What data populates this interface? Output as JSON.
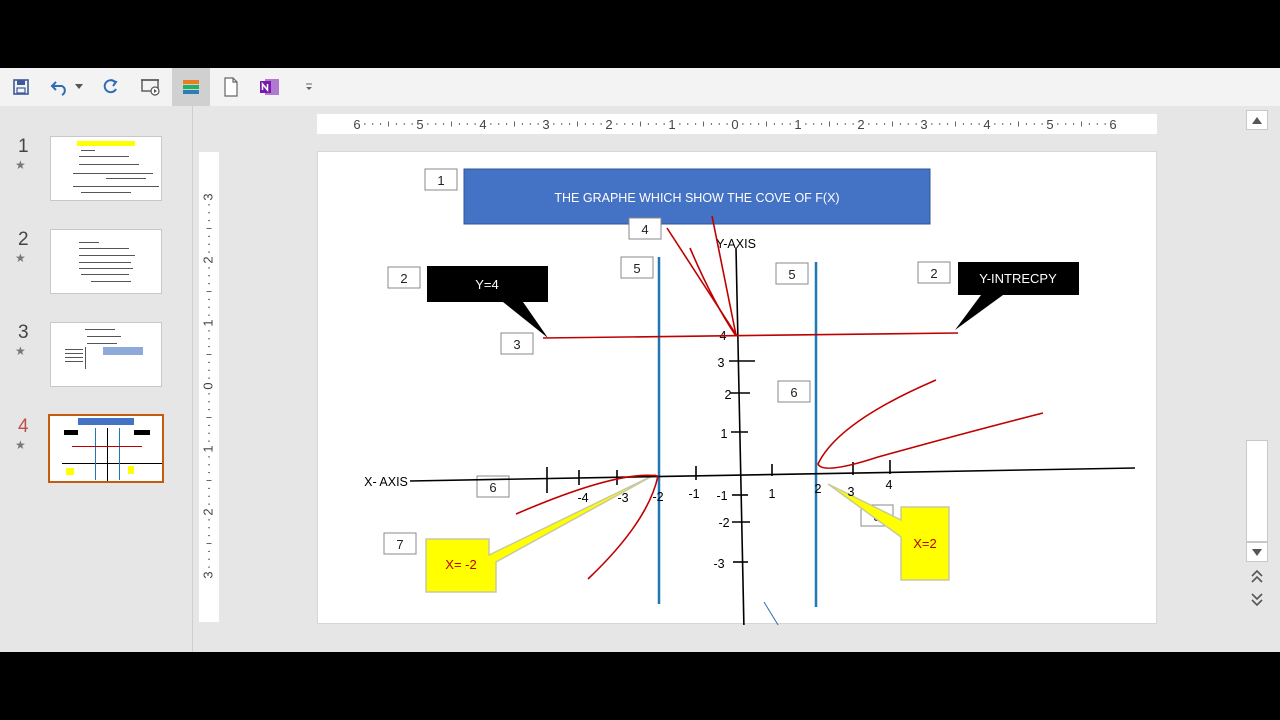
{
  "qat": {
    "icons": [
      "save-icon",
      "undo-icon",
      "undo-dropdown-icon",
      "redo-icon",
      "slideshow-from-start-icon",
      "layout-icon",
      "new-slide-icon",
      "onenote-icon",
      "customize-qat-icon"
    ]
  },
  "thumbnails": [
    {
      "number": "1",
      "active": false
    },
    {
      "number": "2",
      "active": false
    },
    {
      "number": "3",
      "active": false
    },
    {
      "number": "4",
      "active": true
    }
  ],
  "rulers": {
    "horizontal_labels": [
      "6",
      "5",
      "4",
      "3",
      "2",
      "1",
      "0",
      "1",
      "2",
      "3",
      "4",
      "5",
      "6"
    ],
    "vertical_labels": [
      "3",
      "2",
      "1",
      "0",
      "1",
      "2",
      "3"
    ]
  },
  "slide": {
    "title": "THE GRAPHE WHICH SHOW THE COVE OF F(X)",
    "y_axis_label": "Y-AXIS",
    "x_axis_label": "X- AXIS",
    "callouts": {
      "y4": "Y=4",
      "y_intercept": "Y-INTRECPY",
      "x_minus2": "X= -2",
      "x_plus2": "X=2"
    },
    "number_boxes": {
      "b1": "1",
      "b2a": "2",
      "b2b": "2",
      "b3": "3",
      "b4": "4",
      "b5a": "5",
      "b5b": "5",
      "b6a": "6",
      "b6b": "6",
      "b7": "7",
      "b8": "8"
    },
    "ticks": {
      "y4": "4",
      "y3": "3",
      "y2": "2",
      "y1": "1",
      "ym1": "-1",
      "ym2": "-2",
      "ym3": "-3",
      "xm4": "-4",
      "xm3": "-3",
      "xm2": "-2",
      "xm1": "-1",
      "x1": "1",
      "x2": "2",
      "x3": "3",
      "x4": "4"
    },
    "colors": {
      "title_fill": "#4472c4",
      "asymptote": "#1f77b4",
      "curve": "#c00000",
      "callout_black": "#000000",
      "callout_yellow": "#ffff00",
      "callout_yellow_text": "#c00000"
    }
  }
}
